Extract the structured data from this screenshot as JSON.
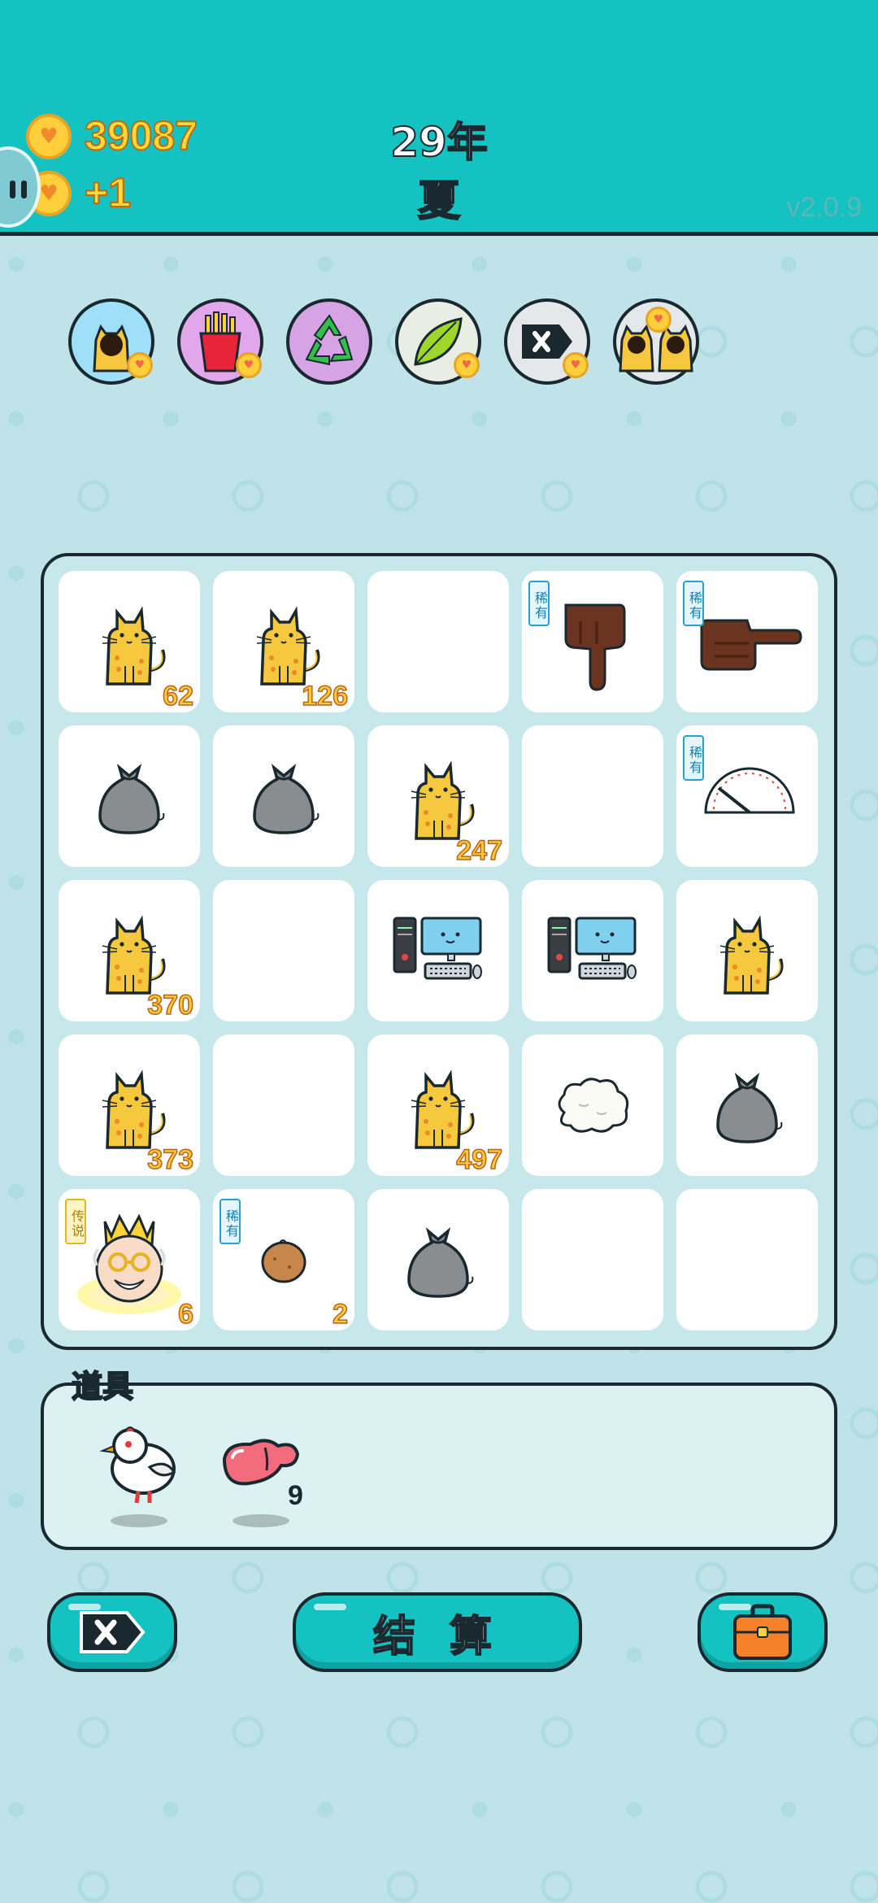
{
  "header": {
    "coins": "39087",
    "income": "+1",
    "year": "29年",
    "season": "夏",
    "version": "v2.0.9"
  },
  "buffs": [
    {
      "name": "cat-buff-icon",
      "bg": "#9fdff7"
    },
    {
      "name": "fries-buff-icon",
      "bg": "#e2a6ea"
    },
    {
      "name": "recycle-buff-icon",
      "bg": "#d6a3e4"
    },
    {
      "name": "leaf-buff-icon",
      "bg": "#e9eee4"
    },
    {
      "name": "delete-buff-icon",
      "bg": "#e4e8ea"
    },
    {
      "name": "twin-cats-buff-icon",
      "bg": "#e4e8ea"
    }
  ],
  "grid": {
    "rows": [
      [
        {
          "item": "cat",
          "count": "62"
        },
        {
          "item": "cat",
          "count": "126"
        },
        {
          "item": "empty",
          "count": ""
        },
        {
          "item": "hand-down",
          "tag": "稀有",
          "count": ""
        },
        {
          "item": "hand-right",
          "tag": "稀有",
          "count": ""
        }
      ],
      [
        {
          "item": "trash-bag",
          "count": ""
        },
        {
          "item": "trash-bag",
          "count": ""
        },
        {
          "item": "cat",
          "count": "247"
        },
        {
          "item": "empty",
          "count": ""
        },
        {
          "item": "gauge",
          "tag": "稀有",
          "count": ""
        }
      ],
      [
        {
          "item": "cat",
          "count": "370"
        },
        {
          "item": "empty",
          "count": ""
        },
        {
          "item": "computer",
          "count": ""
        },
        {
          "item": "computer",
          "count": ""
        },
        {
          "item": "cat",
          "count": ""
        }
      ],
      [
        {
          "item": "cat",
          "count": "373"
        },
        {
          "item": "empty",
          "count": ""
        },
        {
          "item": "cat",
          "count": "497"
        },
        {
          "item": "cloud",
          "count": ""
        },
        {
          "item": "trash-bag",
          "count": ""
        }
      ],
      [
        {
          "item": "king",
          "tag": "传说",
          "count": "6"
        },
        {
          "item": "potato",
          "tag": "稀有",
          "count": "2"
        },
        {
          "item": "trash-bag",
          "count": ""
        },
        {
          "item": "empty",
          "count": ""
        },
        {
          "item": "empty",
          "count": ""
        }
      ]
    ]
  },
  "props": {
    "title": "道具",
    "items": [
      {
        "name": "bird",
        "count": ""
      },
      {
        "name": "liver",
        "count": "9"
      }
    ]
  },
  "buttons": {
    "settle": "结 算"
  },
  "colors": {
    "header": "#14c3c1",
    "outline": "#1a2830",
    "count_gold": "#ffc93a"
  }
}
